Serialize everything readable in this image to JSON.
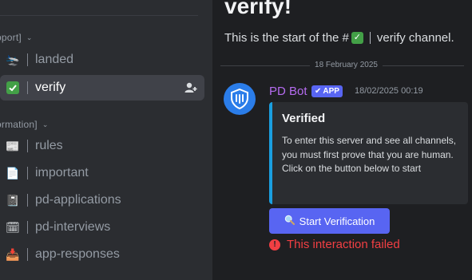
{
  "sidebar": {
    "categories": [
      {
        "label": "pport]"
      },
      {
        "label": "ormation]"
      }
    ],
    "channels": [
      {
        "name": "landed",
        "icon": "airplane-landing-icon",
        "emoji": "🛬"
      },
      {
        "name": "verify",
        "icon": "check-box-icon",
        "emoji": "✅",
        "active": true
      },
      {
        "name": "rules",
        "icon": "newspaper-icon",
        "emoji": "📰"
      },
      {
        "name": "important",
        "icon": "document-icon",
        "emoji": "📄"
      },
      {
        "name": "pd-applications",
        "icon": "notebook-icon",
        "emoji": "📓"
      },
      {
        "name": "pd-interviews",
        "icon": "calendar-icon",
        "emoji": "🗓"
      },
      {
        "name": "app-responses",
        "icon": "inbox-icon",
        "emoji": "📥"
      }
    ]
  },
  "main": {
    "title": "verify!",
    "subtitle_prefix": "This is the start of the #",
    "subtitle_suffix": "verify channel.",
    "date_divider": "18 February 2025",
    "message": {
      "author": "PD Bot",
      "badge": "APP",
      "timestamp": "18/02/2025 00:19",
      "embed": {
        "title": "Verified",
        "description": "To enter this server and see all channels, you must first prove that you are human. Click on the button below to start",
        "accent_color": "#1a9fe0"
      },
      "button_label": "Start Verification",
      "error_text": "This interaction failed"
    }
  },
  "colors": {
    "blurple": "#5865f2",
    "error": "#f23f43",
    "author": "#b56cf0"
  }
}
